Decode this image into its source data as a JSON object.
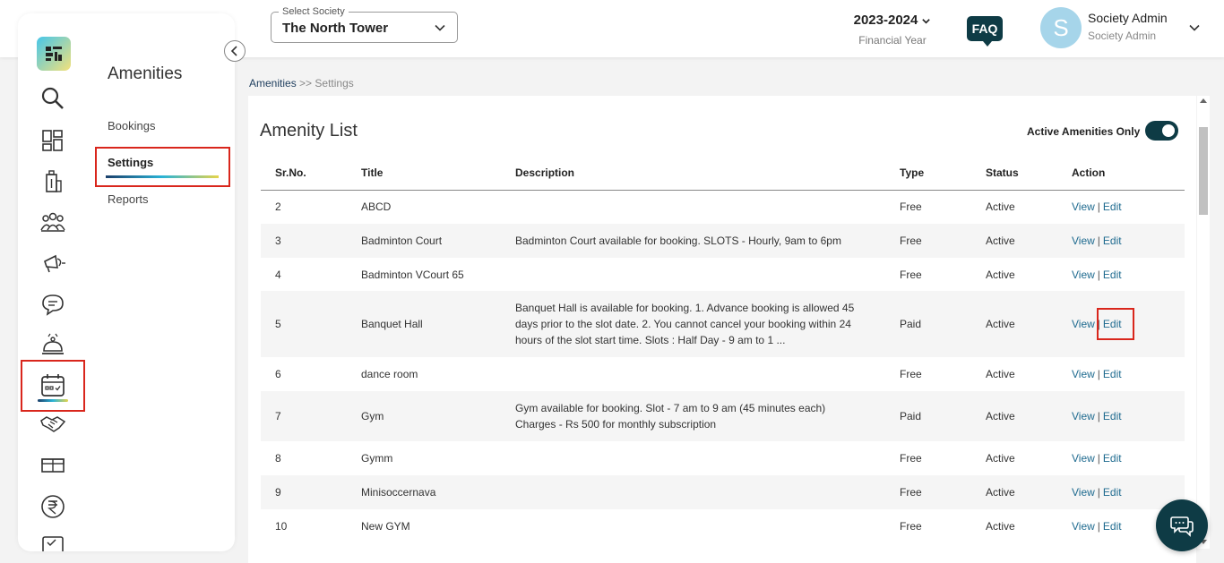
{
  "header": {
    "society_select": {
      "legend": "Select Society",
      "value": "The North Tower"
    },
    "financial_year": {
      "year": "2023-2024",
      "label": "Financial Year"
    },
    "faq_label": "FAQ",
    "user": {
      "avatar_letter": "S",
      "name": "Society Admin",
      "role": "Society Admin"
    }
  },
  "sidebar": {
    "icons": [
      "search-icon",
      "dashboard-icon",
      "building-icon",
      "members-icon",
      "announcement-icon",
      "chat-icon",
      "service-icon",
      "amenities-calendar-icon",
      "handshake-icon",
      "parcel-icon",
      "rupee-icon",
      "checklist-icon"
    ],
    "active_icon": "amenities-calendar-icon"
  },
  "submenu": {
    "title": "Amenities",
    "items": [
      "Bookings",
      "Settings",
      "Reports"
    ],
    "active": "Settings"
  },
  "breadcrumb": {
    "parent": "Amenities",
    "separator": ">>",
    "current": "Settings"
  },
  "panel": {
    "title": "Amenity List",
    "toggle_label": "Active Amenities Only",
    "toggle_on": true
  },
  "table": {
    "columns": [
      "Sr.No.",
      "Title",
      "Description",
      "Type",
      "Status",
      "Action"
    ],
    "action_view": "View",
    "action_edit": "Edit",
    "action_sep": "|",
    "rows": [
      {
        "sr": "2",
        "title": "ABCD",
        "description": "",
        "type": "Free",
        "status": "Active"
      },
      {
        "sr": "3",
        "title": "Badminton Court",
        "description": "Badminton Court available for booking. SLOTS - Hourly, 9am to 6pm",
        "type": "Free",
        "status": "Active"
      },
      {
        "sr": "4",
        "title": "Badminton VCourt 65",
        "description": "",
        "type": "Free",
        "status": "Active"
      },
      {
        "sr": "5",
        "title": "Banquet Hall",
        "description": "Banquet Hall is available for booking.  1. Advance booking is allowed 45 days prior to the slot date. 2. You cannot cancel your booking within 24 hours of the slot start time. Slots :  Half Day - 9 am to 1 ...",
        "type": "Paid",
        "status": "Active"
      },
      {
        "sr": "6",
        "title": "dance room",
        "description": "",
        "type": "Free",
        "status": "Active"
      },
      {
        "sr": "7",
        "title": "Gym",
        "description": "Gym available for booking. Slot - 7 am to 9 am (45 minutes each) Charges - Rs 500 for monthly subscription",
        "type": "Paid",
        "status": "Active"
      },
      {
        "sr": "8",
        "title": "Gymm",
        "description": "",
        "type": "Free",
        "status": "Active"
      },
      {
        "sr": "9",
        "title": "Minisoccernava",
        "description": "",
        "type": "Free",
        "status": "Active"
      },
      {
        "sr": "10",
        "title": "New GYM",
        "description": "",
        "type": "Free",
        "status": "Active"
      }
    ]
  },
  "colors": {
    "accent_dark": "#0e3b45",
    "link": "#1e6a8f",
    "highlight": "#d9261c"
  }
}
